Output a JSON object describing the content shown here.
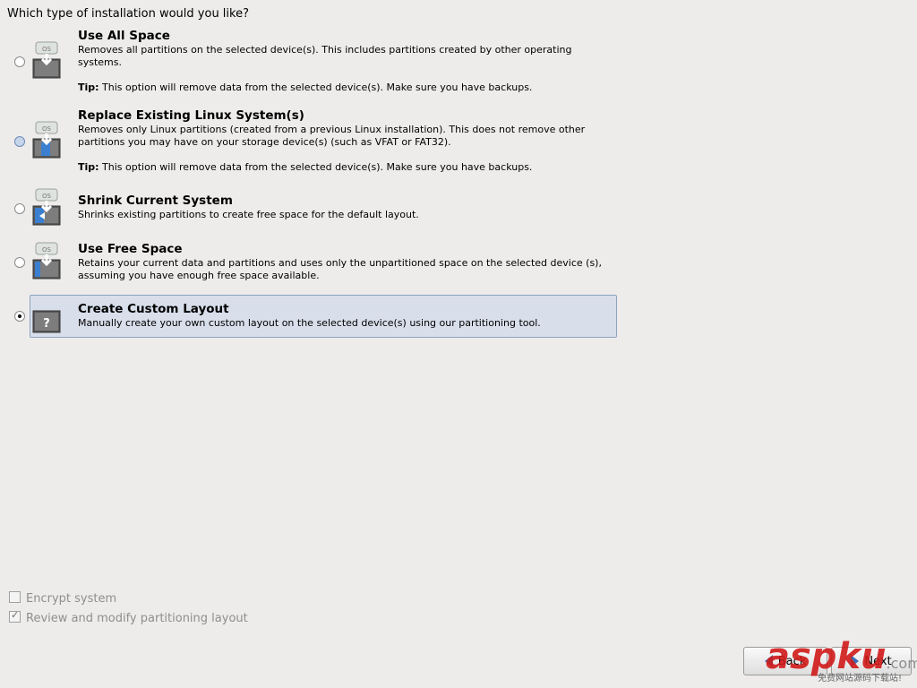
{
  "question": "Which type of installation would you like?",
  "options": [
    {
      "title": "Use All Space",
      "description": "Removes all partitions on the selected device(s).  This includes partitions created by other operating systems.",
      "tip_label": "Tip:",
      "tip_text": "This option will remove data from the selected device(s).  Make sure you have backups.",
      "icon_badge": "OS",
      "state": "unchecked"
    },
    {
      "title": "Replace Existing Linux System(s)",
      "description": "Removes only Linux partitions (created from a previous Linux installation).  This does not remove other partitions you may have on your storage device(s) (such as VFAT or FAT32).",
      "tip_label": "Tip:",
      "tip_text": "This option will remove data from the selected device(s).  Make sure you have backups.",
      "icon_badge": "OS",
      "state": "hover"
    },
    {
      "title": "Shrink Current System",
      "description": "Shrinks existing partitions to create free space for the default layout.",
      "icon_badge": "OS",
      "state": "unchecked"
    },
    {
      "title": "Use Free Space",
      "description": "Retains your current data and partitions and uses only the unpartitioned space on the selected device (s), assuming you have enough free space available.",
      "icon_badge": "OS",
      "state": "unchecked"
    },
    {
      "title": "Create Custom Layout",
      "description": "Manually create your own custom layout on the selected device(s) using our partitioning tool.",
      "icon_badge": "?",
      "state": "checked"
    }
  ],
  "checkboxes": [
    {
      "label": "Encrypt system",
      "checked": false
    },
    {
      "label": "Review and modify partitioning layout",
      "checked": true
    }
  ],
  "buttons": {
    "back_label": "Back",
    "next_label": "Next"
  },
  "watermark": {
    "brand": "aspku",
    "tld": ".com",
    "tagline": "免费网站源码下载站!"
  },
  "colors": {
    "accent": "#3b6fb6",
    "selected_bg": "#d8deea"
  }
}
